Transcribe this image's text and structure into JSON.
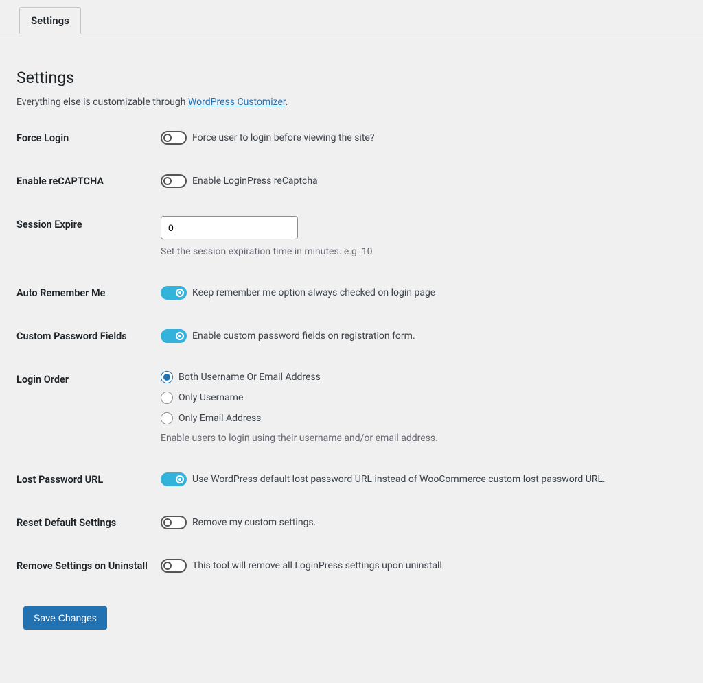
{
  "tab": {
    "label": "Settings"
  },
  "page": {
    "title": "Settings",
    "desc_pre": "Everything else is customizable through ",
    "desc_link": "WordPress Customizer",
    "desc_post": "."
  },
  "fields": {
    "force_login": {
      "label": "Force Login",
      "desc": "Force user to login before viewing the site?",
      "on": false
    },
    "enable_recaptcha": {
      "label": "Enable reCAPTCHA",
      "desc": "Enable LoginPress reCaptcha",
      "on": false
    },
    "session_expire": {
      "label": "Session Expire",
      "value": "0",
      "hint": "Set the session expiration time in minutes. e.g: 10"
    },
    "auto_remember": {
      "label": "Auto Remember Me",
      "desc": "Keep remember me option always checked on login page",
      "on": true
    },
    "custom_password": {
      "label": "Custom Password Fields",
      "desc": "Enable custom password fields on registration form.",
      "on": true
    },
    "login_order": {
      "label": "Login Order",
      "options": {
        "both": "Both Username Or Email Address",
        "username": "Only Username",
        "email": "Only Email Address"
      },
      "hint": "Enable users to login using their username and/or email address."
    },
    "lost_password": {
      "label": "Lost Password URL",
      "desc": "Use WordPress default lost password URL instead of WooCommerce custom lost password URL.",
      "on": true
    },
    "reset_defaults": {
      "label": "Reset Default Settings",
      "desc": "Remove my custom settings.",
      "on": false
    },
    "remove_uninstall": {
      "label": "Remove Settings on Uninstall",
      "desc": "This tool will remove all LoginPress settings upon uninstall.",
      "on": false
    }
  },
  "submit": {
    "label": "Save Changes"
  }
}
